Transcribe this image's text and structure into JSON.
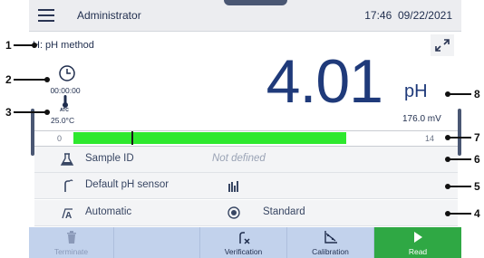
{
  "header": {
    "user": "Administrator",
    "time": "17:46",
    "date": "09/22/2021"
  },
  "method": {
    "label": "H: pH method"
  },
  "indicators": {
    "timer": "00:00:00",
    "atc_label": "ATC",
    "temperature": "25.0°C"
  },
  "reading": {
    "value": "4.01",
    "unit": "pH",
    "mv": "176.0 mV"
  },
  "range": {
    "min_label": "0",
    "max_label": "14",
    "min": 0,
    "max": 14,
    "green_start": 1.3,
    "green_end": 10.3,
    "marker": 3.2
  },
  "rows": [
    {
      "label": "Sample ID",
      "value": "Not defined",
      "icon": "beaker-icon"
    },
    {
      "label": "Default pH sensor",
      "value": "",
      "icon": "sensor-icon",
      "value_icon": "calibration-status-icon"
    },
    {
      "label": "Automatic",
      "value": "Standard",
      "icon": "auto-endpoint-icon",
      "value_icon": "radio-selected-icon"
    }
  ],
  "bottom": {
    "terminate": "Terminate",
    "verification": "Verification",
    "calibration": "Calibration",
    "read": "Read"
  },
  "callouts": [
    "1",
    "2",
    "3",
    "4",
    "5",
    "6",
    "7",
    "8"
  ],
  "colors": {
    "range_green": "#2ee82e",
    "read_button": "#2fa844",
    "bottom_bar": "#c2d2ec",
    "value_text": "#1f3a7a"
  }
}
